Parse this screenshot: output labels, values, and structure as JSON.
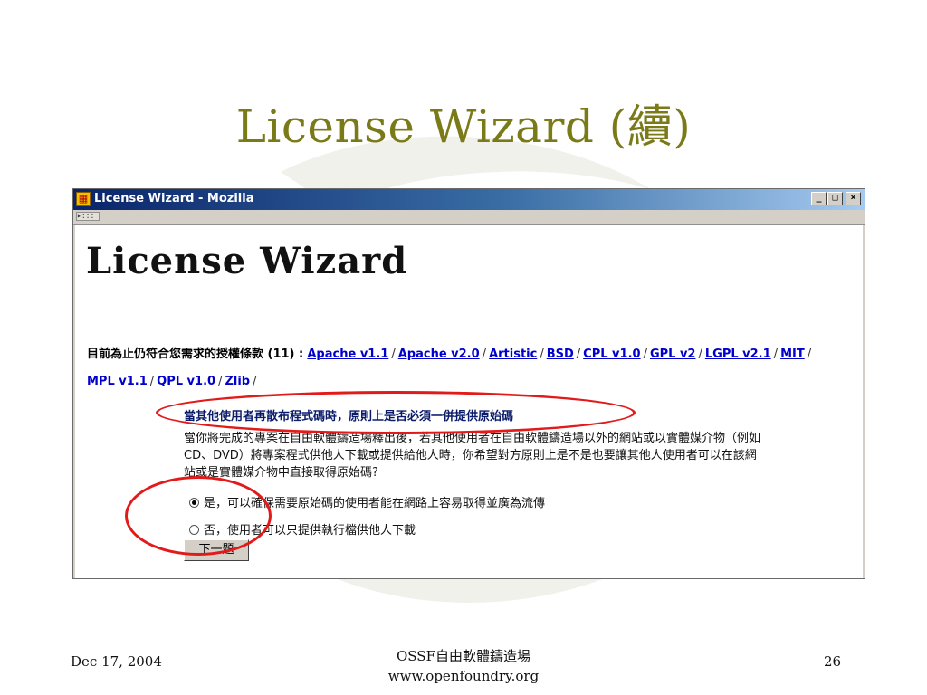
{
  "slide": {
    "title": "License Wizard (續)",
    "footer_date": "Dec 17, 2004",
    "footer_org": "OSSF自由軟體鑄造場",
    "footer_url": "www.openfoundry.org",
    "page_number": "26"
  },
  "window": {
    "title": "License Wizard - Mozilla",
    "minimize_label": "_",
    "maximize_label": "□",
    "close_label": "×",
    "grip_label": "▸:::"
  },
  "page": {
    "heading": "License Wizard",
    "match_label": "目前為止仍符合您需求的授權條款 (11) :",
    "licenses": [
      "Apache v1.1",
      "Apache v2.0",
      "Artistic",
      "BSD",
      "CPL v1.0",
      "GPL v2",
      "LGPL v2.1",
      "MIT",
      "MPL v1.1",
      "QPL v1.0",
      "Zlib"
    ],
    "separator": "/",
    "question": "當其他使用者再散布程式碼時，原則上是否必須一併提供原始碼",
    "description": "當你將完成的專案在自由軟體鑄造場釋出後，若其他使用者在自由軟體鑄造場以外的網站或以實體媒介物（例如CD、DVD）將專案程式供他人下載或提供給他人時，你希望對方原則上是不是也要讓其他人使用者可以在該網站或是實體媒介物中直接取得原始碼?",
    "option_yes": "是，可以確保需要原始碼的使用者能在網路上容易取得並廣為流傳",
    "option_no": "否，使用者可以只提供執行檔供他人下載",
    "next_button": "下一題"
  },
  "colors": {
    "title": "#7a7a18",
    "link": "#0000cc",
    "question": "#0a1b6a",
    "annotation": "#e21a1a"
  }
}
